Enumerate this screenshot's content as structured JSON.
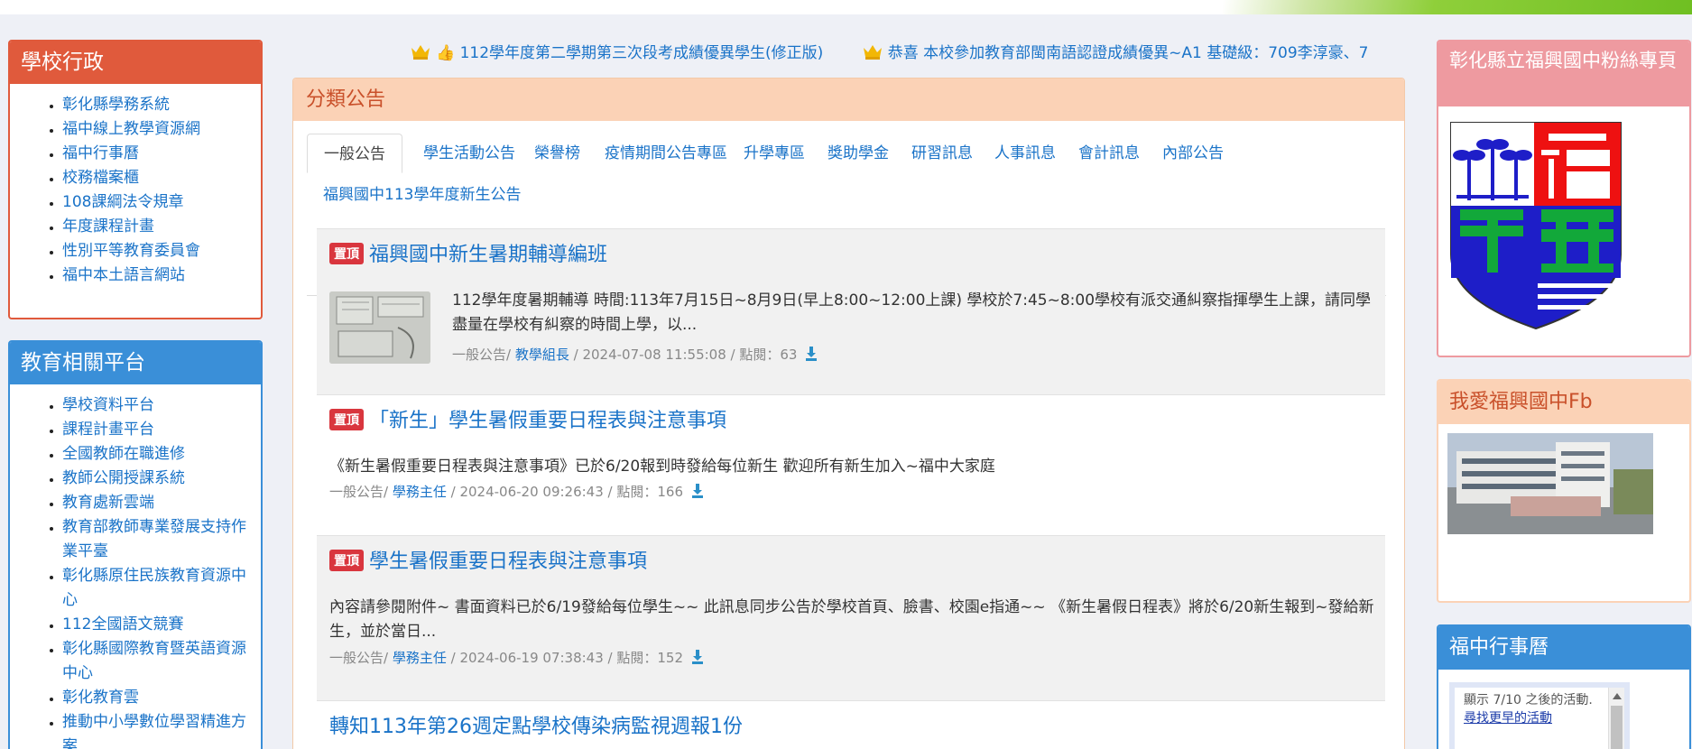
{
  "left": {
    "admin": {
      "title": "學校行政",
      "items": [
        "彰化縣學務系統",
        "福中線上教學資源網",
        "福中行事曆",
        "校務檔案櫃",
        "108課綱法令規章",
        "年度課程計畫",
        "性別平等教育委員會",
        "福中本土語言網站"
      ]
    },
    "edu": {
      "title": "教育相關平台",
      "items": [
        "學校資料平台",
        "課程計畫平台",
        "全國教師在職進修",
        "教師公開授課系統",
        "教育處新雲端",
        "教育部教師專業發展支持作業平臺",
        "彰化縣原住民族教育資源中心",
        "112全國語文競賽",
        "彰化縣國際教育暨英語資源中心",
        "彰化教育雲",
        "推動中小學數位學習精進方案"
      ]
    }
  },
  "marquee": {
    "item1": "👍 112學年度第二學期第三次段考成績優異學生(修正版)",
    "item2": "恭喜 本校參加教育部閩南語認證成績優異~A1 基礎級：709李淳豪、7"
  },
  "main": {
    "title": "分類公告",
    "tabs": [
      "一般公告",
      "學生活動公告",
      "榮譽榜",
      "疫情期間公告專區",
      "升學專區",
      "獎助學金",
      "研習訊息",
      "人事訊息",
      "會計訊息",
      "內部公告",
      "福興國中113學年度新生公告"
    ],
    "pin_label": "置頂",
    "items": [
      {
        "title": "福興國中新生暑期輔導編班",
        "desc": "112學年度暑期輔導 時間:113年7月15日~8月9日(早上8:00~12:00上課) 學校於7:45~8:00學校有派交通糾察指揮學生上課，請同學盡量在學校有糾察的時間上學，以...",
        "cat": "一般公告/",
        "author": "教學組長",
        "meta": "/ 2024-07-08 11:55:08 / 點閱：63"
      },
      {
        "title": "「新生」學生暑假重要日程表與注意事項",
        "desc": "《新生暑假重要日程表與注意事項》已於6/20報到時發給每位新生 歡迎所有新生加入~福中大家庭",
        "cat": "一般公告/",
        "author": "學務主任",
        "meta": "/ 2024-06-20 09:26:43 / 點閱：166"
      },
      {
        "title": "學生暑假重要日程表與注意事項",
        "desc": "內容請參閱附件~ 書面資料已於6/19發給每位學生~~ 此訊息同步公告於學校首頁、臉書、校園e指通~~ 《新生暑假日程表》將於6/20新生報到~發給新生，並於當日...",
        "cat": "一般公告/",
        "author": "學務主任",
        "meta": "/ 2024-06-19 07:38:43 / 點閱：152"
      },
      {
        "title": "轉知113年第26週定點學校傳染病監視週報1份"
      }
    ]
  },
  "right": {
    "fan_title": "彰化縣立福興國中粉絲專頁",
    "logo_text": "福興國中",
    "fb_title": "我愛福興國中Fb",
    "cal_title": "福中行事曆",
    "cal_text": "顯示 7/10 之後的活動.",
    "cal_link": "尋找更早的活動"
  },
  "colors": {
    "admin": "#e05a3c",
    "edu": "#3a8fd8",
    "pin": "#d9363e",
    "link": "#1a73c8"
  }
}
